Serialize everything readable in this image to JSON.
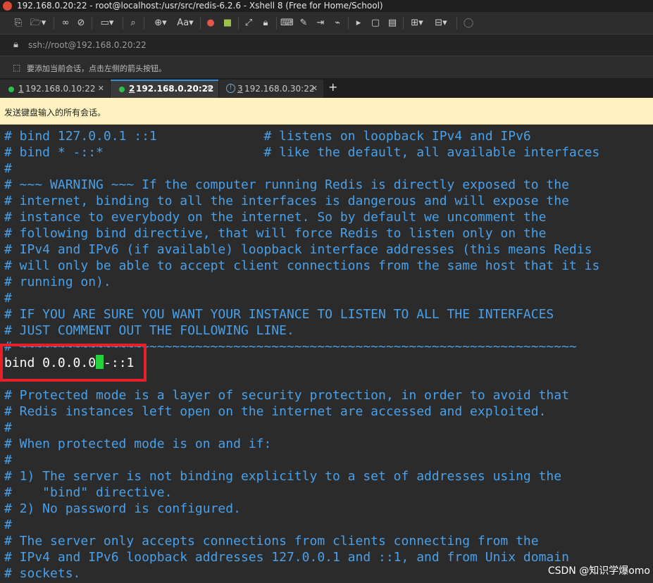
{
  "window": {
    "title": "192.168.0.20:22 - root@localhost:/usr/src/redis-6.2.6 - Xshell 8 (Free for Home/School)",
    "icon": "xshell-logo-icon"
  },
  "toolbar": {
    "font_label": "Aa"
  },
  "addressbar": {
    "url": "ssh://root@192.168.0.20:22"
  },
  "hintbar": {
    "text": "要添加当前会话，点击左侧的箭头按钮。"
  },
  "tabs": [
    {
      "num": "1",
      "label": "192.168.0.10:22",
      "status": "connected",
      "active": false
    },
    {
      "num": "2",
      "label": "192.168.0.20:22",
      "status": "connected",
      "active": true
    },
    {
      "num": "3",
      "label": "192.168.0.30:22",
      "status": "info",
      "active": false
    }
  ],
  "tab_add_label": "+",
  "tab_close_label": "✕",
  "sendbar": {
    "text": "发送键盘输入的所有会话。"
  },
  "terminal": {
    "lines": [
      "# bind 127.0.0.1 ::1              # listens on loopback IPv4 and IPv6",
      "# bind * -::*                     # like the default, all available interfaces",
      "#",
      "# ~~~ WARNING ~~~ If the computer running Redis is directly exposed to the",
      "# internet, binding to all the interfaces is dangerous and will expose the",
      "# instance to everybody on the internet. So by default we uncomment the",
      "# following bind directive, that will force Redis to listen only on the",
      "# IPv4 and IPv6 (if available) loopback interface addresses (this means Redis",
      "# will only be able to accept client connections from the same host that it is",
      "# running on).",
      "#",
      "# IF YOU ARE SURE YOU WANT YOUR INSTANCE TO LISTEN TO ALL THE INTERFACES",
      "# JUST COMMENT OUT THE FOLLOWING LINE.",
      "# ~~~~~~~~~~~~~~~~~~~~~~~~~~~~~~~~~~~~~~~~~~~~~~~~~~~~~~~~~~~~~~~~~~~~~~~~~",
      "",
      "",
      "# Protected mode is a layer of security protection, in order to avoid that",
      "# Redis instances left open on the internet are accessed and exploited.",
      "#",
      "# When protected mode is on and if:",
      "#",
      "# 1) The server is not binding explicitly to a set of addresses using the",
      "#    \"bind\" directive.",
      "# 2) No password is configured.",
      "#",
      "# The server only accepts connections from clients connecting from the",
      "# IPv4 and IPv6 loopback addresses 127.0.0.1 and ::1, and from Unix domain",
      "# sockets."
    ],
    "bind_before_cursor": "bind 0.0.0.0",
    "bind_after_cursor": "-::1"
  },
  "watermark": "CSDN @知识学爆omo",
  "colors": {
    "terminal_text": "#4aa0e8",
    "terminal_bg": "#2b2b2b",
    "cursor": "#26d140",
    "highlight_box": "#e5202a",
    "sendbar_bg": "#fdf2c0"
  }
}
